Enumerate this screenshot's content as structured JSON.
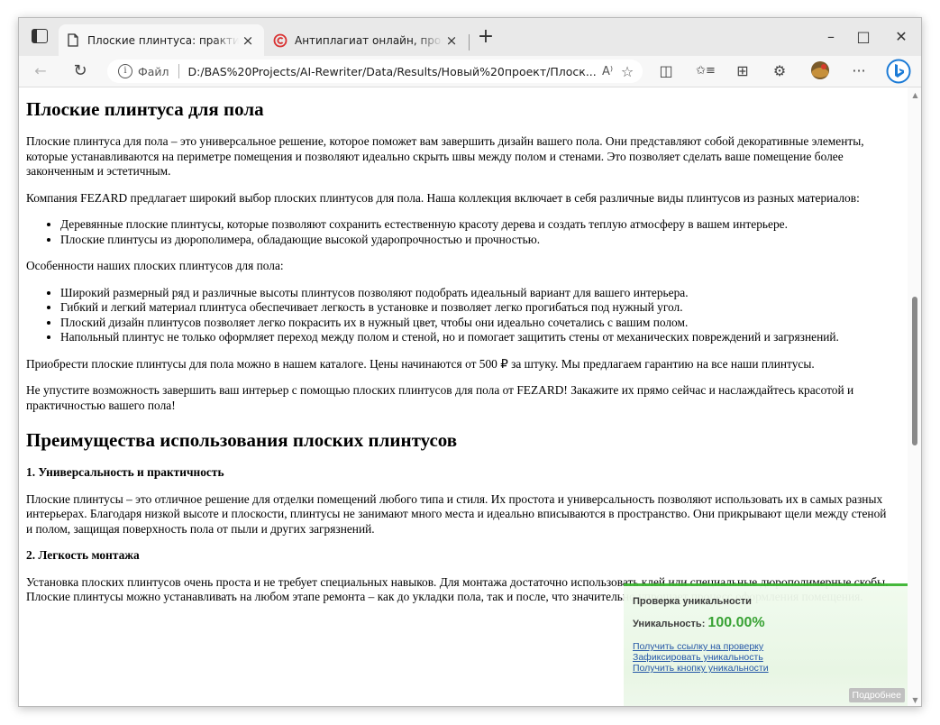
{
  "browser": {
    "tabs": [
      {
        "title": "Плоские плинтуса: практичные и стильные",
        "active": true
      },
      {
        "title": "Антиплагиат онлайн, проверка уникальности",
        "active": false
      }
    ],
    "address": {
      "protocol": "Файл",
      "url": "D:/BAS%20Projects/AI-Rewriter/Data/Results/Новый%20проект/Плоск..."
    },
    "icons": {
      "tab_actions": "tab-actions-icon",
      "new_tab": "+",
      "minimize": "–",
      "maximize": "□",
      "close": "✕",
      "back": "←",
      "refresh": "↻",
      "read_aloud": "A⁾",
      "favorite": "☆",
      "split": "◫",
      "favorites": "✩≡",
      "collections": "⊞",
      "extensions": "⚙",
      "more": "···"
    }
  },
  "doc": {
    "h1": "Плоские плинтуса для пола",
    "p1": "Плоские плинтуса для пола – это универсальное решение, которое поможет вам завершить дизайн вашего пола. Они представляют собой декоративные элементы, которые устанавливаются на периметре помещения и позволяют идеально скрыть швы между полом и стенами. Это позволяет сделать ваше помещение более законченным и эстетичным.",
    "p2": "Компания FEZARD предлагает широкий выбор плоских плинтусов для пола. Наша коллекция включает в себя различные виды плинтусов из разных материалов:",
    "list1": [
      "Деревянные плоские плинтусы, которые позволяют сохранить естественную красоту дерева и создать теплую атмосферу в вашем интерьере.",
      "Плоские плинтусы из дюрополимера, обладающие высокой ударопрочностью и прочностью."
    ],
    "p3": "Особенности наших плоских плинтусов для пола:",
    "list2": [
      "Широкий размерный ряд и различные высоты плинтусов позволяют подобрать идеальный вариант для вашего интерьера.",
      "Гибкий и легкий материал плинтуса обеспечивает легкость в установке и позволяет легко прогибаться под нужный угол.",
      "Плоский дизайн плинтусов позволяет легко покрасить их в нужный цвет, чтобы они идеально сочетались с вашим полом.",
      "Напольный плинтус не только оформляет переход между полом и стеной, но и помогает защитить стены от механических повреждений и загрязнений."
    ],
    "p4": "Приобрести плоские плинтусы для пола можно в нашем каталоге. Цены начинаются от 500 ₽ за штуку. Мы предлагаем гарантию на все наши плинтусы.",
    "p5": "Не упустите возможность завершить ваш интерьер с помощью плоских плинтусов для пола от FEZARD! Закажите их прямо сейчас и наслаждайтесь красотой и практичностью вашего пола!",
    "h2": "Преимущества использования плоских плинтусов",
    "h3a": "1. Универсальность и практичность",
    "p6": "Плоские плинтусы – это отличное решение для отделки помещений любого типа и стиля. Их простота и универсальность позволяют использовать их в самых разных интерьерах. Благодаря низкой высоте и плоскости, плинтусы не занимают много места и идеально вписываются в пространство. Они прикрывают щели между стеной и полом, защищая поверхность пола от пыли и других загрязнений.",
    "h3b": "2. Легкость монтажа",
    "p7": "Установка плоских плинтусов очень проста и не требует специальных навыков. Для монтажа достаточно использовать клей или специальные дюрополимерные скобы. Плоские плинтусы можно устанавливать на любом этапе ремонта – как до укладки пола, так и после, что значительно упрощает процесс оформления помещения."
  },
  "widget": {
    "title": "Проверка уникальности",
    "uniqueness_label": "Уникальность:",
    "uniqueness_value": "100.00%",
    "links": [
      "Получить ссылку на проверку",
      "Зафиксировать уникальность",
      "Получить кнопку уникальности"
    ],
    "more_button": "Подробнее",
    "accent_color": "#3cb531"
  }
}
